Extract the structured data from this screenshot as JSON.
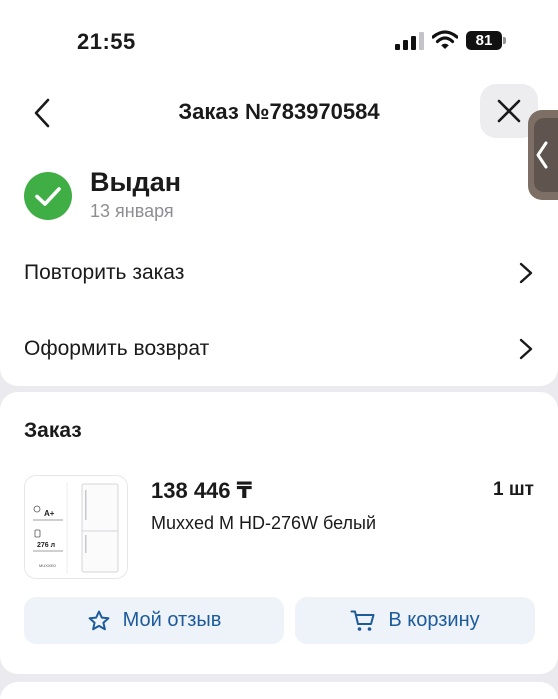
{
  "status_bar": {
    "time": "21:55",
    "battery": "81"
  },
  "header": {
    "title": "Заказ №783970584"
  },
  "order_status": {
    "title": "Выдан",
    "date": "13 января"
  },
  "actions": [
    {
      "label": "Повторить заказ"
    },
    {
      "label": "Оформить возврат"
    }
  ],
  "order": {
    "heading": "Заказ",
    "product": {
      "price": "138 446 ₸",
      "quantity": "1 шт",
      "name": "Muxxed M HD-276W белый",
      "thumb_texts": {
        "energy": "A+",
        "volume": "276 л",
        "brand": "MUXXED"
      }
    },
    "buttons": {
      "review": "Мой отзыв",
      "cart": "В корзину"
    }
  },
  "colors": {
    "accent": "#1d5b9b",
    "success": "#3fae45",
    "button_bg": "#eef3f9"
  }
}
